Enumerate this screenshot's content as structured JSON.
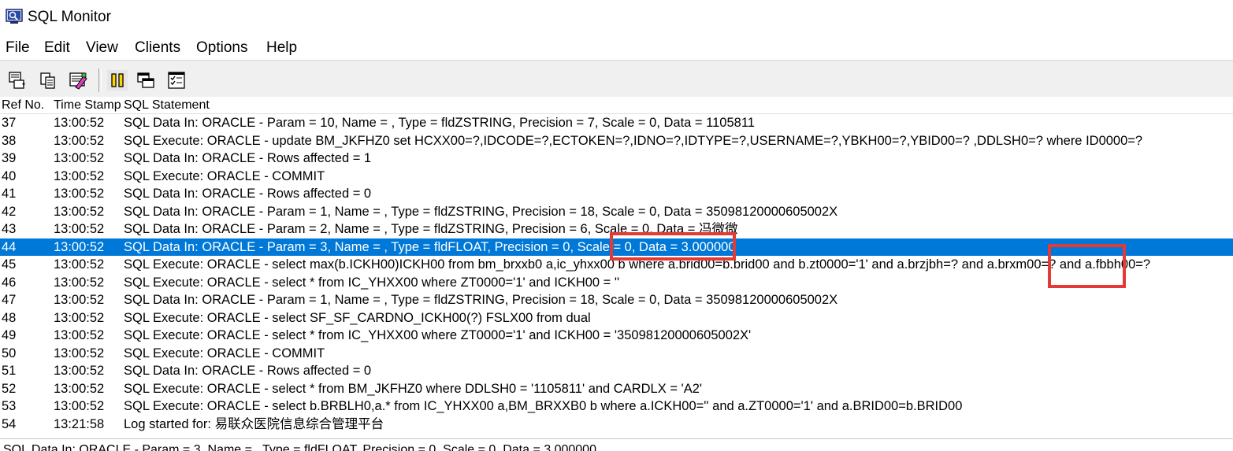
{
  "window": {
    "title": "SQL Monitor",
    "icon": "sql-monitor-app-icon"
  },
  "menu": [
    "File",
    "Edit",
    "View",
    "Clients",
    "Options",
    "Help"
  ],
  "toolbar": {
    "buttons": [
      {
        "icon": "save-log-icon"
      },
      {
        "icon": "copy-icon"
      },
      {
        "icon": "clear-icon"
      },
      {
        "icon": "pause-icon",
        "pressed": true
      },
      {
        "icon": "stay-on-top-icon"
      },
      {
        "icon": "trace-options-icon"
      }
    ]
  },
  "columns": {
    "ref": "Ref No.",
    "time": "Time Stamp",
    "sql": "SQL Statement"
  },
  "rows": [
    {
      "ref": "37",
      "time": "13:00:52",
      "sql": "SQL Data In: ORACLE - Param = 10, Name = , Type = fldZSTRING, Precision = 7, Scale = 0, Data = 1105811"
    },
    {
      "ref": "38",
      "time": "13:00:52",
      "sql": "SQL Execute: ORACLE - update BM_JKFHZ0 set HCXX00=?,IDCODE=?,ECTOKEN=?,IDNO=?,IDTYPE=?,USERNAME=?,YBKH00=?,YBID00=? ,DDLSH0=? where ID0000=?"
    },
    {
      "ref": "39",
      "time": "13:00:52",
      "sql": "SQL Data In: ORACLE - Rows affected = 1"
    },
    {
      "ref": "40",
      "time": "13:00:52",
      "sql": "SQL Execute: ORACLE - COMMIT"
    },
    {
      "ref": "41",
      "time": "13:00:52",
      "sql": "SQL Data In: ORACLE - Rows affected = 0"
    },
    {
      "ref": "42",
      "time": "13:00:52",
      "sql": "SQL Data In: ORACLE - Param = 1, Name = , Type = fldZSTRING, Precision = 18, Scale = 0, Data = 35098120000605002X"
    },
    {
      "ref": "43",
      "time": "13:00:52",
      "sql": "SQL Data In: ORACLE - Param = 2, Name = , Type = fldZSTRING, Precision = 6, Scale = 0, Data = 冯微微"
    },
    {
      "ref": "44",
      "time": "13:00:52",
      "sql": "SQL Data In: ORACLE - Param = 3, Name = , Type = fldFLOAT, Precision = 0, Scale = 0, Data = 3.000000",
      "selected": true
    },
    {
      "ref": "45",
      "time": "13:00:52",
      "sql": "SQL Execute: ORACLE - select  max(b.ICKH00)ICKH00  from bm_brxxb0 a,ic_yhxx00 b where a.brid00=b.brid00 and b.zt0000='1' and a.brzjbh=? and a.brxm00=? and a.fbbh00=?"
    },
    {
      "ref": "46",
      "time": "13:00:52",
      "sql": "SQL Execute: ORACLE - select *  from IC_YHXX00 where ZT0000='1' and  ICKH00 = ''"
    },
    {
      "ref": "47",
      "time": "13:00:52",
      "sql": "SQL Data In: ORACLE - Param = 1, Name = , Type = fldZSTRING, Precision = 18, Scale = 0, Data = 35098120000605002X"
    },
    {
      "ref": "48",
      "time": "13:00:52",
      "sql": "SQL Execute: ORACLE - select SF_SF_CARDNO_ICKH00(?) FSLX00 from dual"
    },
    {
      "ref": "49",
      "time": "13:00:52",
      "sql": "SQL Execute: ORACLE - select *  from IC_YHXX00 where ZT0000='1' and  ICKH00 = '35098120000605002X'"
    },
    {
      "ref": "50",
      "time": "13:00:52",
      "sql": "SQL Execute: ORACLE - COMMIT"
    },
    {
      "ref": "51",
      "time": "13:00:52",
      "sql": "SQL Data In: ORACLE - Rows affected = 0"
    },
    {
      "ref": "52",
      "time": "13:00:52",
      "sql": "SQL Execute: ORACLE - select * from BM_JKFHZ0 where DDLSH0 = '1105811' and CARDLX = 'A2'"
    },
    {
      "ref": "53",
      "time": "13:00:52",
      "sql": "SQL Execute: ORACLE - select b.BRBLH0,a.* from IC_YHXX00 a,BM_BRXXB0 b where a.ICKH00='' and a.ZT0000='1' and a.BRID00=b.BRID00"
    },
    {
      "ref": "54",
      "time": "13:21:58",
      "sql": "Log started for: 易联众医院信息综合管理平台"
    }
  ],
  "status": {
    "text": "SQL Data In: ORACLE - Param = 3, Name = , Type = fldFLOAT, Precision = 0, Scale = 0, Data = 3.000000"
  },
  "annotation_color": "#e53935",
  "selection_color": "#0078d7"
}
